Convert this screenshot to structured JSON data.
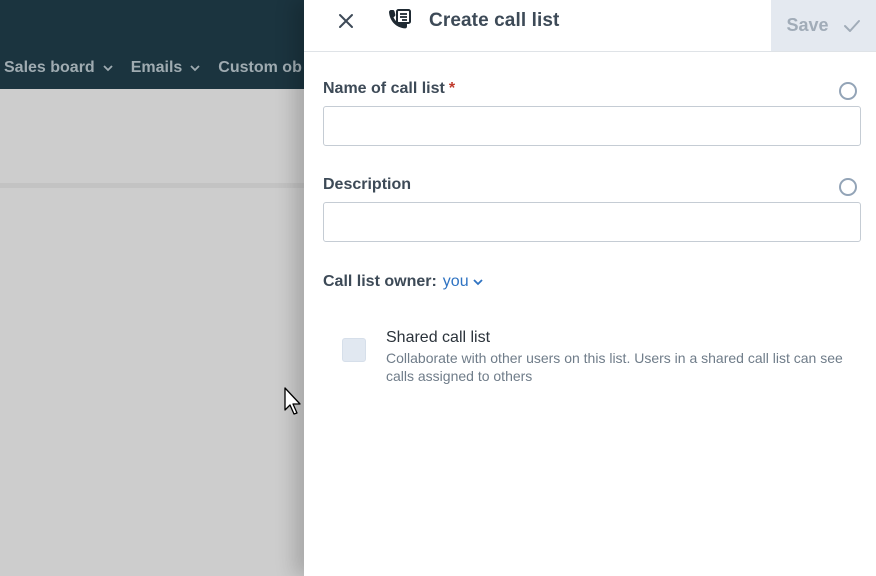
{
  "background": {
    "nav_items": [
      {
        "label": "Sales board"
      },
      {
        "label": "Emails"
      },
      {
        "label": "Custom ob"
      }
    ]
  },
  "drawer": {
    "title": "Create call list",
    "save_label": "Save",
    "fields": {
      "name": {
        "label": "Name of call list",
        "required_marker": "*",
        "value": "",
        "placeholder": ""
      },
      "description": {
        "label": "Description",
        "value": "",
        "placeholder": ""
      }
    },
    "owner": {
      "label": "Call list owner:",
      "value": "you"
    },
    "shared": {
      "title": "Shared call list",
      "description": "Collaborate with other users on this list. Users in a shared call list can see calls assigned to others",
      "checked": false
    }
  },
  "colors": {
    "header_bg": "#1b343f",
    "accent_link": "#2f73c2",
    "required": "#c0392b",
    "save_disabled_bg": "#e4e9f0"
  },
  "icons": {
    "close": "close-icon",
    "call_list": "call-list-icon",
    "check": "check-icon",
    "chevron": "chevron-down-icon",
    "status": "status-circle-icon"
  }
}
